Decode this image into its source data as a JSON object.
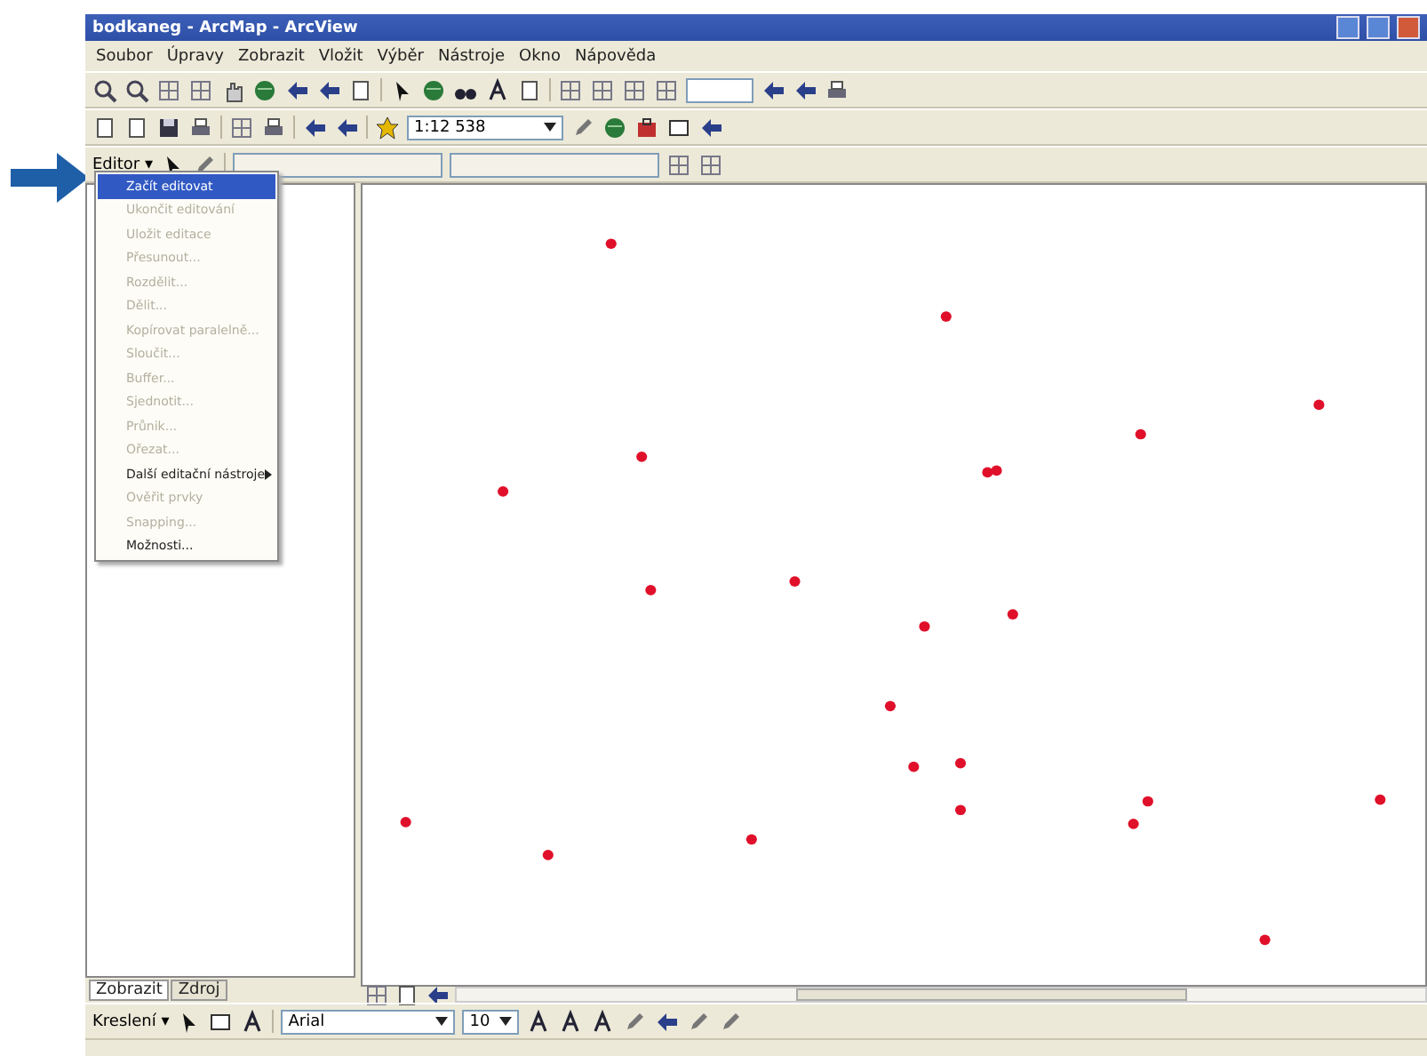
{
  "window": {
    "title": "bodkaneg - ArcMap - ArcView"
  },
  "menu_bar": [
    "Soubor",
    "Úpravy",
    "Zobrazit",
    "Vložit",
    "Výběr",
    "Nástroje",
    "Okno",
    "Nápověda"
  ],
  "standard_toolbar": {
    "scale": "1:12 538"
  },
  "editor_toolbar": {
    "label": "Editor ▾"
  },
  "editor_menu": [
    {
      "label": "Začít editovat",
      "disabled": false,
      "selected": true
    },
    {
      "label": "Ukončit editování",
      "disabled": true,
      "selected": false
    },
    {
      "label": "Uložit editace",
      "disabled": true,
      "selected": false
    },
    {
      "label": "Přesunout...",
      "disabled": true,
      "selected": false
    },
    {
      "label": "Rozdělit...",
      "disabled": true,
      "selected": false
    },
    {
      "label": "Dělit...",
      "disabled": true,
      "selected": false
    },
    {
      "label": "Kopírovat paralelně...",
      "disabled": true,
      "selected": false
    },
    {
      "label": "Sloučit...",
      "disabled": true,
      "selected": false
    },
    {
      "label": "Buffer...",
      "disabled": true,
      "selected": false
    },
    {
      "label": "Sjednotit...",
      "disabled": true,
      "selected": false
    },
    {
      "label": "Průnik...",
      "disabled": true,
      "selected": false
    },
    {
      "label": "Ořezat...",
      "disabled": true,
      "selected": false
    },
    {
      "label": "Další editační nástroje",
      "disabled": false,
      "selected": false,
      "submenu": true
    },
    {
      "label": "Ověřit prvky",
      "disabled": true,
      "selected": false
    },
    {
      "label": "Snapping...",
      "disabled": true,
      "selected": false
    },
    {
      "label": "Možnosti...",
      "disabled": false,
      "selected": false
    }
  ],
  "toc_tabs": [
    {
      "label": "Zobrazit",
      "selected": true
    },
    {
      "label": "Zdroj",
      "selected": false
    }
  ],
  "drawing_toolbar": {
    "label": "Kreslení ▾",
    "font": "Arial",
    "size": "10"
  }
}
